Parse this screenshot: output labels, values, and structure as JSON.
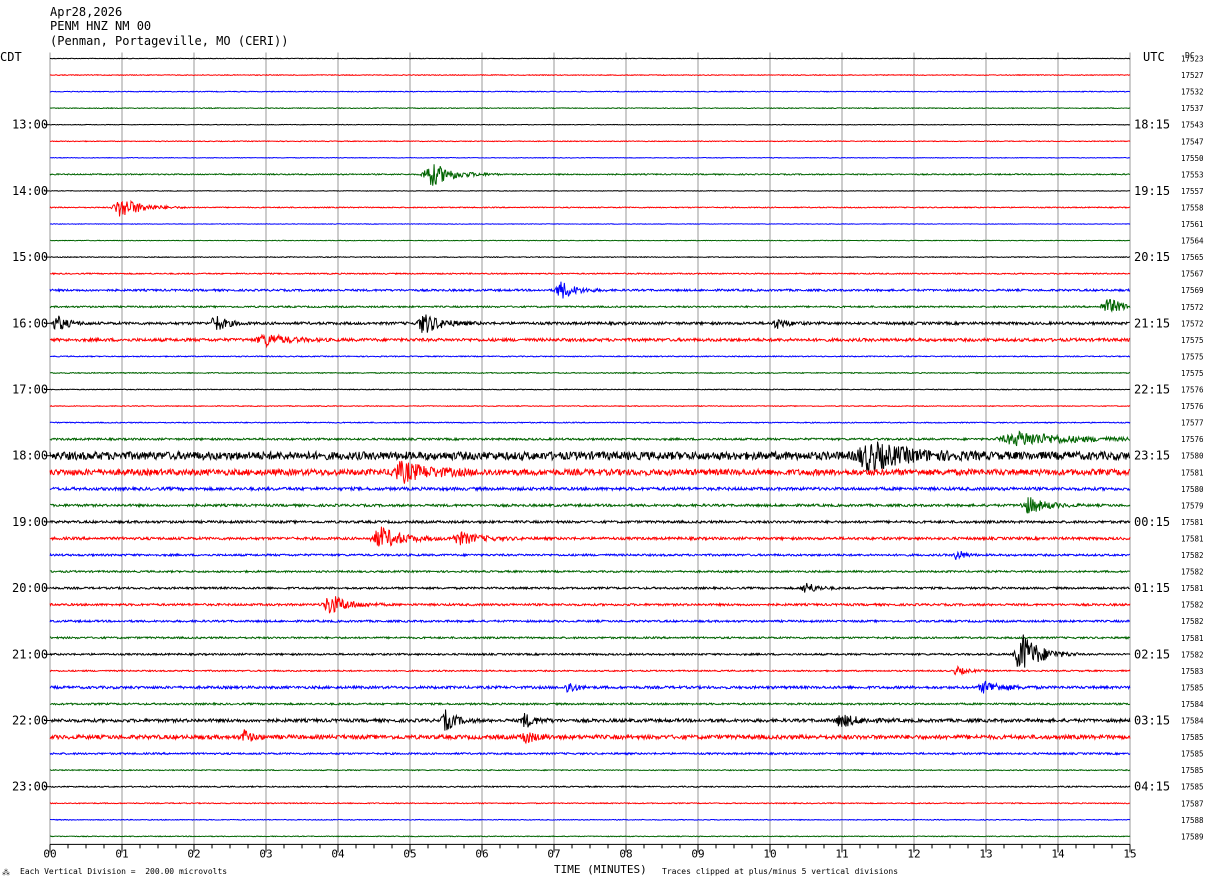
{
  "header": {
    "date": "Apr28,2026",
    "station": "PENM HNZ NM 00",
    "location": "(Penman, Portageville, MO (CERI))"
  },
  "tz_left": "CDT",
  "tz_right": "UTC",
  "dc_label": "DC",
  "footer": {
    "scale_note": "Each Vertical Division =  200.00 microvolts",
    "clip_note": "Traces clipped at plus/minus 5 vertical divisions"
  },
  "chart_data": {
    "type": "line",
    "xlabel": "TIME (MINUTES)",
    "xlim": [
      0,
      15
    ],
    "x_ticks": [
      "00",
      "01",
      "02",
      "03",
      "04",
      "05",
      "06",
      "07",
      "08",
      "09",
      "10",
      "11",
      "12",
      "13",
      "14",
      "15"
    ],
    "left_hour_labels": [
      "13:00",
      "14:00",
      "15:00",
      "16:00",
      "17:00",
      "18:00",
      "19:00",
      "20:00",
      "21:00",
      "22:00",
      "23:00"
    ],
    "right_hour_labels": [
      "18:15",
      "19:15",
      "20:15",
      "21:15",
      "22:15",
      "23:15",
      "00:15",
      "01:15",
      "02:15",
      "03:15",
      "04:15"
    ],
    "trace_colors": [
      "#000000",
      "#ff0000",
      "#0000ff",
      "#006400"
    ],
    "trace_dc_values": [
      "17523",
      "17527",
      "17532",
      "17537",
      "17543",
      "17547",
      "17550",
      "17553",
      "17557",
      "17558",
      "17561",
      "17564",
      "17565",
      "17567",
      "17569",
      "17572",
      "17572",
      "17575",
      "17575",
      "17575",
      "17576",
      "17576",
      "17577",
      "17576",
      "17580",
      "17581",
      "17580",
      "17579",
      "17581",
      "17581",
      "17582",
      "17582",
      "17581",
      "17582",
      "17582",
      "17581",
      "17582",
      "17583",
      "17585",
      "17584",
      "17584",
      "17585",
      "17585",
      "17585",
      "17585",
      "17587",
      "17588",
      "17589"
    ],
    "trace_noise": [
      0.3,
      0.4,
      0.4,
      0.4,
      0.3,
      0.4,
      0.3,
      0.6,
      0.3,
      0.5,
      0.3,
      0.3,
      0.4,
      0.6,
      1.0,
      0.8,
      1.3,
      1.5,
      0.5,
      0.5,
      0.4,
      0.4,
      0.5,
      1.0,
      4.0,
      3.0,
      1.5,
      1.2,
      1.2,
      1.3,
      1.0,
      0.9,
      1.0,
      1.1,
      1.0,
      0.9,
      0.9,
      0.7,
      1.3,
      0.9,
      1.6,
      2.0,
      0.9,
      0.5,
      0.6,
      0.5,
      0.4,
      0.4
    ],
    "events": [
      {
        "trace": 7,
        "minute": 5.3,
        "amplitude": 12,
        "duration": 0.6
      },
      {
        "trace": 9,
        "minute": 1.0,
        "amplitude": 10,
        "duration": 0.6
      },
      {
        "trace": 14,
        "minute": 7.1,
        "amplitude": 9,
        "duration": 0.4
      },
      {
        "trace": 15,
        "minute": 14.7,
        "amplitude": 8,
        "duration": 0.5
      },
      {
        "trace": 16,
        "minute": 0.1,
        "amplitude": 8,
        "duration": 0.3
      },
      {
        "trace": 16,
        "minute": 2.3,
        "amplitude": 9,
        "duration": 0.3
      },
      {
        "trace": 16,
        "minute": 5.2,
        "amplitude": 10,
        "duration": 0.5
      },
      {
        "trace": 16,
        "minute": 10.1,
        "amplitude": 5,
        "duration": 0.3
      },
      {
        "trace": 17,
        "minute": 3.0,
        "amplitude": 6,
        "duration": 0.6
      },
      {
        "trace": 23,
        "minute": 13.5,
        "amplitude": 7,
        "duration": 1.5
      },
      {
        "trace": 24,
        "minute": 11.4,
        "amplitude": 13,
        "duration": 1.0
      },
      {
        "trace": 25,
        "minute": 4.9,
        "amplitude": 9,
        "duration": 0.8
      },
      {
        "trace": 27,
        "minute": 13.6,
        "amplitude": 8,
        "duration": 0.5
      },
      {
        "trace": 29,
        "minute": 4.6,
        "amplitude": 11,
        "duration": 0.6
      },
      {
        "trace": 29,
        "minute": 5.7,
        "amplitude": 6,
        "duration": 0.6
      },
      {
        "trace": 30,
        "minute": 12.6,
        "amplitude": 6,
        "duration": 0.2
      },
      {
        "trace": 32,
        "minute": 10.5,
        "amplitude": 6,
        "duration": 0.3
      },
      {
        "trace": 33,
        "minute": 3.9,
        "amplitude": 10,
        "duration": 0.5
      },
      {
        "trace": 36,
        "minute": 13.5,
        "amplitude": 22,
        "duration": 0.5
      },
      {
        "trace": 37,
        "minute": 12.6,
        "amplitude": 4,
        "duration": 0.3
      },
      {
        "trace": 38,
        "minute": 7.2,
        "amplitude": 7,
        "duration": 0.2
      },
      {
        "trace": 38,
        "minute": 13.0,
        "amplitude": 6,
        "duration": 0.5
      },
      {
        "trace": 40,
        "minute": 5.5,
        "amplitude": 10,
        "duration": 0.3
      },
      {
        "trace": 40,
        "minute": 6.6,
        "amplitude": 7,
        "duration": 0.3
      },
      {
        "trace": 40,
        "minute": 11.0,
        "amplitude": 6,
        "duration": 0.5
      },
      {
        "trace": 41,
        "minute": 2.7,
        "amplitude": 7,
        "duration": 0.2
      },
      {
        "trace": 41,
        "minute": 6.6,
        "amplitude": 6,
        "duration": 0.3
      }
    ]
  }
}
